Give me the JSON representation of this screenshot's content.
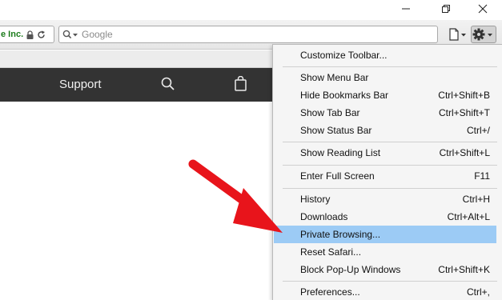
{
  "window": {
    "minimize_label": "Minimize",
    "restore_label": "Restore",
    "close_label": "Close"
  },
  "toolbar": {
    "organization": "e Inc.",
    "search_placeholder": "Google",
    "search_value": ""
  },
  "site": {
    "nav_support": "Support"
  },
  "menu": {
    "items": [
      {
        "label": "Customize Toolbar...",
        "shortcut": ""
      },
      {
        "label": "Show Menu Bar",
        "shortcut": ""
      },
      {
        "label": "Hide Bookmarks Bar",
        "shortcut": "Ctrl+Shift+B"
      },
      {
        "label": "Show Tab Bar",
        "shortcut": "Ctrl+Shift+T"
      },
      {
        "label": "Show Status Bar",
        "shortcut": "Ctrl+/"
      },
      {
        "label": "Show Reading List",
        "shortcut": "Ctrl+Shift+L"
      },
      {
        "label": "Enter Full Screen",
        "shortcut": "F11"
      },
      {
        "label": "History",
        "shortcut": "Ctrl+H"
      },
      {
        "label": "Downloads",
        "shortcut": "Ctrl+Alt+L"
      },
      {
        "label": "Private Browsing...",
        "shortcut": ""
      },
      {
        "label": "Reset Safari...",
        "shortcut": ""
      },
      {
        "label": "Block Pop-Up Windows",
        "shortcut": "Ctrl+Shift+K"
      },
      {
        "label": "Preferences...",
        "shortcut": "Ctrl+,"
      }
    ],
    "highlighted_item": "Private Browsing..."
  },
  "colors": {
    "highlight": "#9ccbf5",
    "arrow": "#e8141b",
    "site_nav": "#333333",
    "org_green": "#1c7c1c"
  },
  "icons": [
    "lock-icon",
    "reload-icon",
    "search-icon",
    "page-icon",
    "gear-icon",
    "bag-icon",
    "arrow-annotation"
  ]
}
